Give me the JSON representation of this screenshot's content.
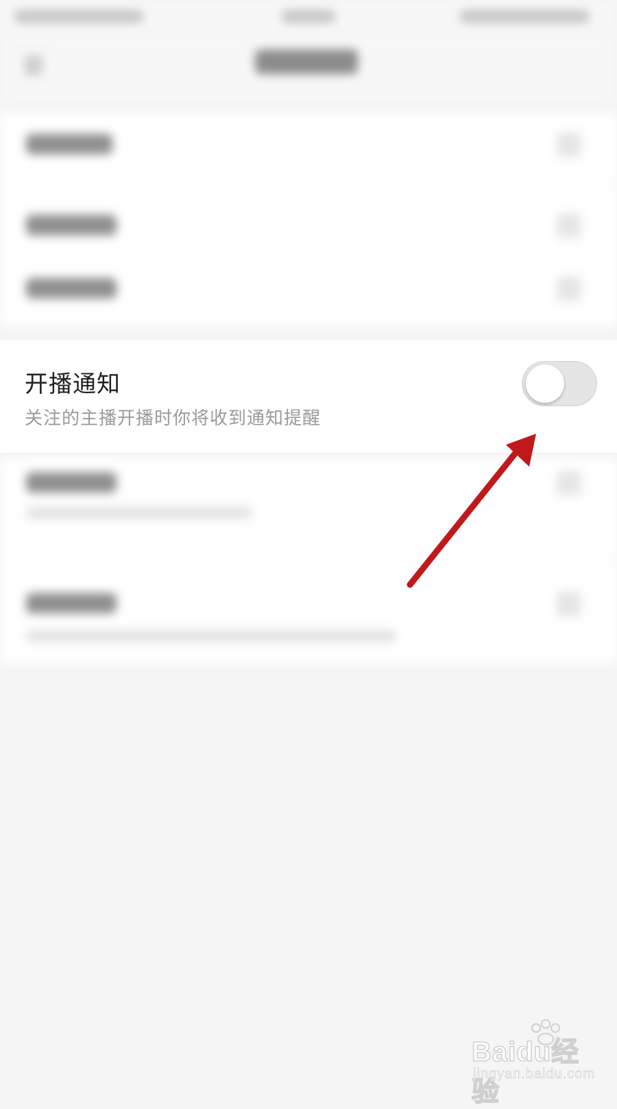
{
  "notification_setting": {
    "title": "开播通知",
    "description": "关注的主播开播时你将收到通知提醒",
    "enabled": false
  },
  "colors": {
    "arrow": "#c0181b",
    "toggle_off": "#e5e5e5",
    "background": "#f5f5f5"
  },
  "watermark": {
    "logo": "Baidu经验",
    "url": "jingyan.baidu.com"
  }
}
